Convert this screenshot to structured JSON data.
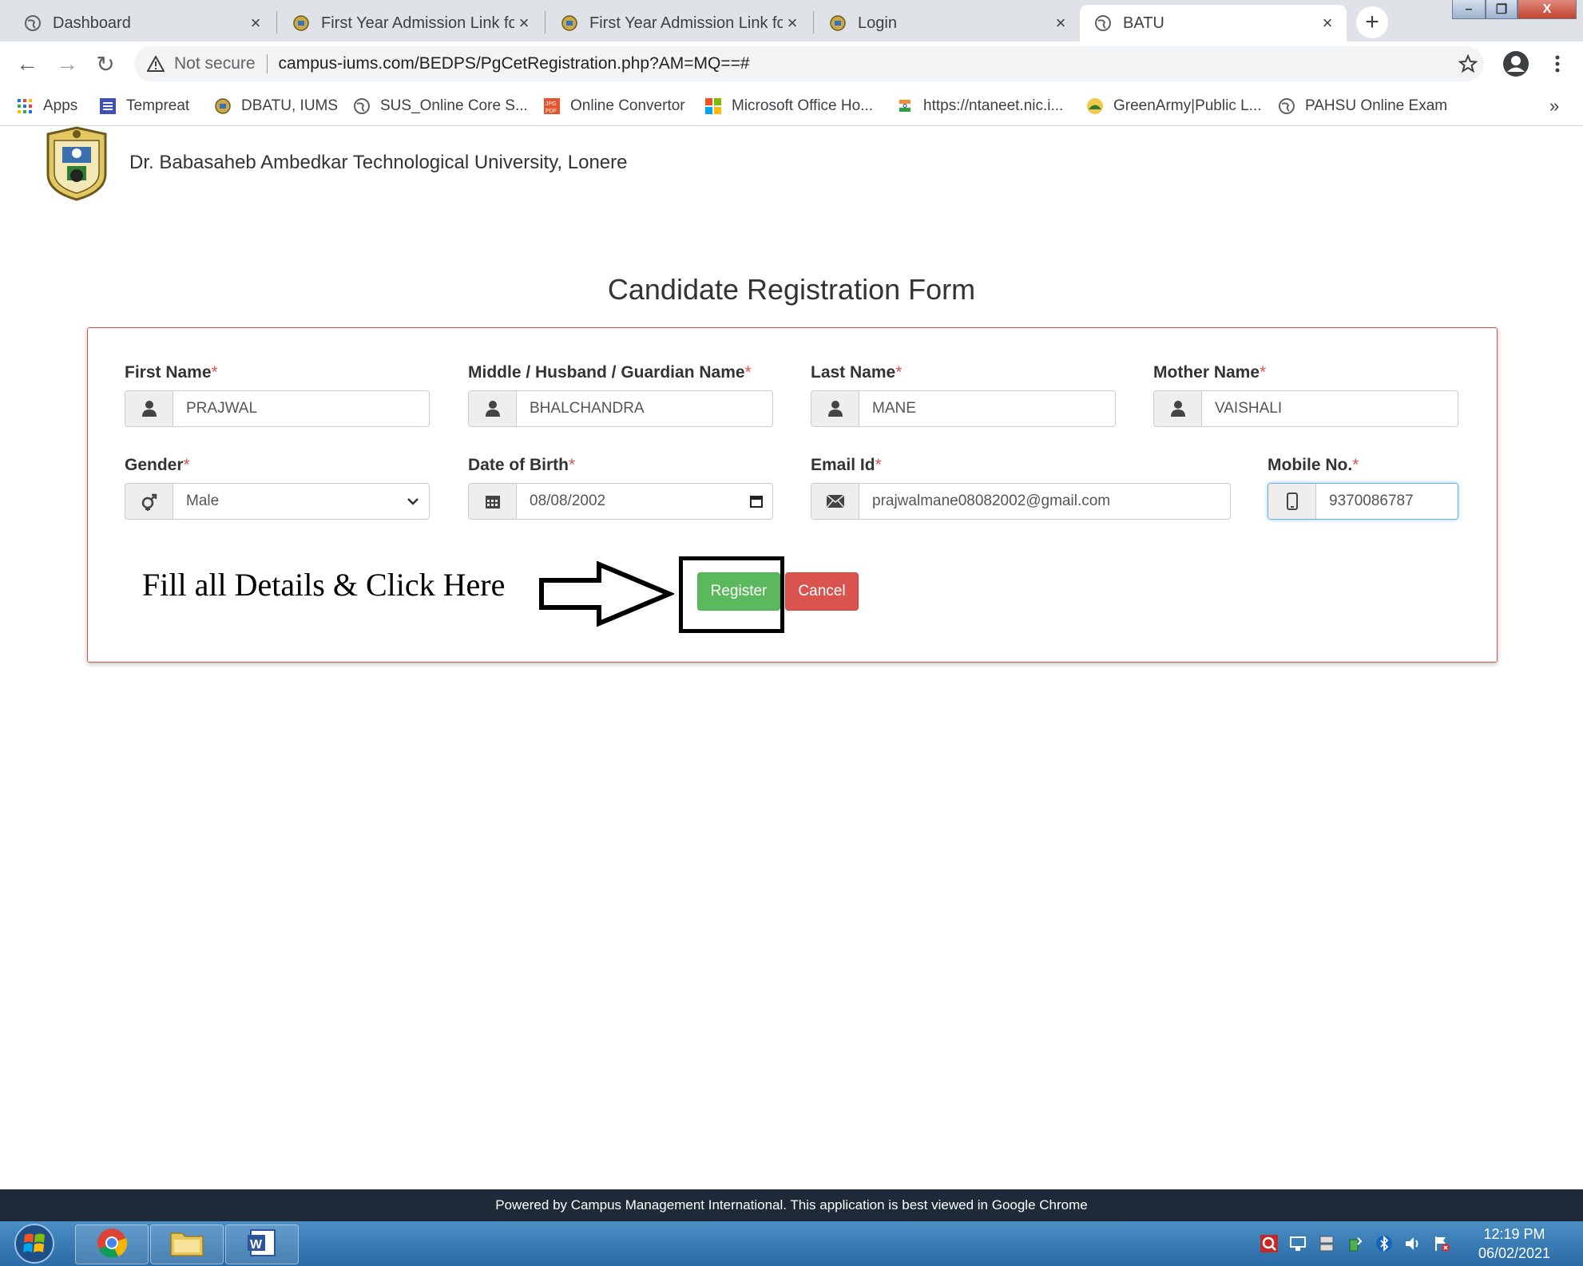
{
  "browser": {
    "tabs": [
      {
        "title": "Dashboard",
        "icon": "globe-icon"
      },
      {
        "title": "First Year Admission Link fo",
        "icon": "university-logo-icon"
      },
      {
        "title": "First Year Admission Link fo",
        "icon": "university-logo-icon"
      },
      {
        "title": "Login",
        "icon": "university-logo-icon"
      },
      {
        "title": "BATU",
        "icon": "globe-icon",
        "active": true
      }
    ],
    "new_tab_label": "+",
    "window_controls": {
      "minimize": "–",
      "maximize": "❐",
      "close": "X"
    },
    "nav": {
      "back": "←",
      "forward": "→",
      "reload": "↻"
    },
    "security_label": "Not secure",
    "url": "campus-iums.com/BEDPS/PgCetRegistration.php?AM=MQ==#",
    "bookmarks": [
      {
        "label": "Apps",
        "icon": "apps-grid-icon"
      },
      {
        "label": "Tempreat",
        "icon": "list-icon"
      },
      {
        "label": "DBATU, IUMS",
        "icon": "university-logo-icon"
      },
      {
        "label": "SUS_Online Core S...",
        "icon": "globe-icon"
      },
      {
        "label": "Online Convertor",
        "icon": "jpg-pdf-icon"
      },
      {
        "label": "Microsoft Office Ho...",
        "icon": "microsoft-icon"
      },
      {
        "label": "https://ntaneet.nic.i...",
        "icon": "emblem-icon"
      },
      {
        "label": "GreenArmy|Public L...",
        "icon": "greenarmy-icon"
      },
      {
        "label": "PAHSU Online Exam",
        "icon": "globe-icon"
      }
    ],
    "bookmarks_overflow": "»"
  },
  "header": {
    "university_name": "Dr. Babasaheb Ambedkar Technological University, Lonere"
  },
  "form": {
    "title": "Candidate Registration Form",
    "required_marker": "*",
    "fields": {
      "first_name": {
        "label": "First Name",
        "value": "PRAJWAL"
      },
      "middle_name": {
        "label": "Middle / Husband / Guardian Name",
        "value": "BHALCHANDRA"
      },
      "last_name": {
        "label": "Last Name",
        "value": "MANE"
      },
      "mother_name": {
        "label": "Mother Name",
        "value": "VAISHALI"
      },
      "gender": {
        "label": "Gender",
        "value": "Male"
      },
      "dob": {
        "label": "Date of Birth",
        "value": "08/08/2002"
      },
      "email": {
        "label": "Email Id",
        "value": "prajwalmane08082002@gmail.com"
      },
      "mobile": {
        "label": "Mobile No.",
        "value": "9370086787"
      }
    },
    "instruction_text": "Fill all Details & Click Here",
    "register_label": "Register",
    "cancel_label": "Cancel",
    "colors": {
      "panel_border": "#d9534f",
      "register": "#5cb85c",
      "cancel": "#d9534f",
      "required": "#d9534f"
    }
  },
  "footer": {
    "text": "Powered by Campus Management International. This application is best viewed in Google Chrome"
  },
  "taskbar": {
    "time": "12:19 PM",
    "date": "06/02/2021"
  }
}
